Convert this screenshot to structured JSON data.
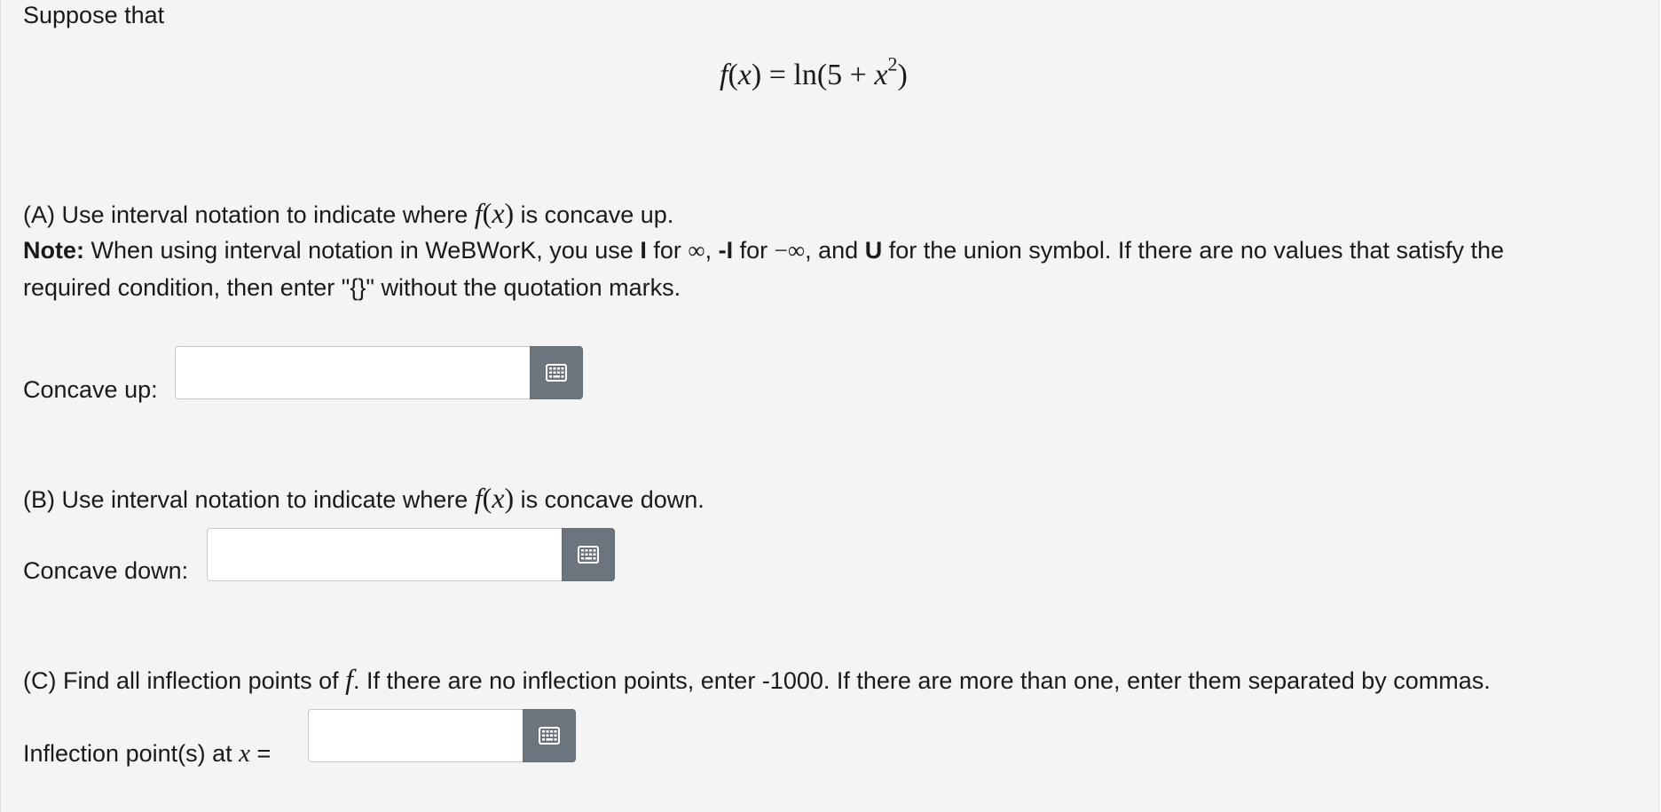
{
  "intro": "Suppose that",
  "equation": {
    "lhs_f": "f",
    "lhs_open": "(",
    "lhs_x": "x",
    "lhs_close": ")",
    "equals": " = ",
    "fn": "ln",
    "rhs_open": "(5 + ",
    "rhs_x": "x",
    "rhs_exp": "2",
    "rhs_close": ")"
  },
  "part_a": {
    "prefix": "(A) Use interval notation to indicate where ",
    "math_f": "f",
    "math_open": "(",
    "math_x": "x",
    "math_close": ")",
    "suffix": " is concave up.",
    "note_label": "Note:",
    "note_text_1": " When using interval notation in WeBWorK, you use ",
    "note_I": "I",
    "note_for_1": " for ",
    "note_inf": "∞",
    "note_comma": ", ",
    "note_negI": "-I",
    "note_for_2": " for ",
    "note_neginf": "−∞",
    "note_and": ", and ",
    "note_U": "U",
    "note_text_2": " for the union symbol. If there are no values that satisfy the",
    "note_line2": "required condition, then enter \"{}\" without the quotation marks.",
    "field_label": "Concave up:",
    "field_value": ""
  },
  "part_b": {
    "prefix": "(B) Use interval notation to indicate where ",
    "math_f": "f",
    "math_open": "(",
    "math_x": "x",
    "math_close": ")",
    "suffix": " is concave down.",
    "field_label": "Concave down:",
    "field_value": ""
  },
  "part_c": {
    "prefix": "(C) Find all inflection points of ",
    "math_f": "f",
    "suffix": ". If there are no inflection points, enter -1000. If there are more than one, enter them separated by commas.",
    "field_label_text": "Inflection point(s) at ",
    "field_label_x": "x",
    "field_label_eq": " =",
    "field_value": ""
  },
  "icons": {
    "palette": "grid-keyboard-icon"
  },
  "colors": {
    "panel_bg": "#f4f4f4",
    "button_bg": "#6c757d",
    "text": "#1a1a1a"
  }
}
